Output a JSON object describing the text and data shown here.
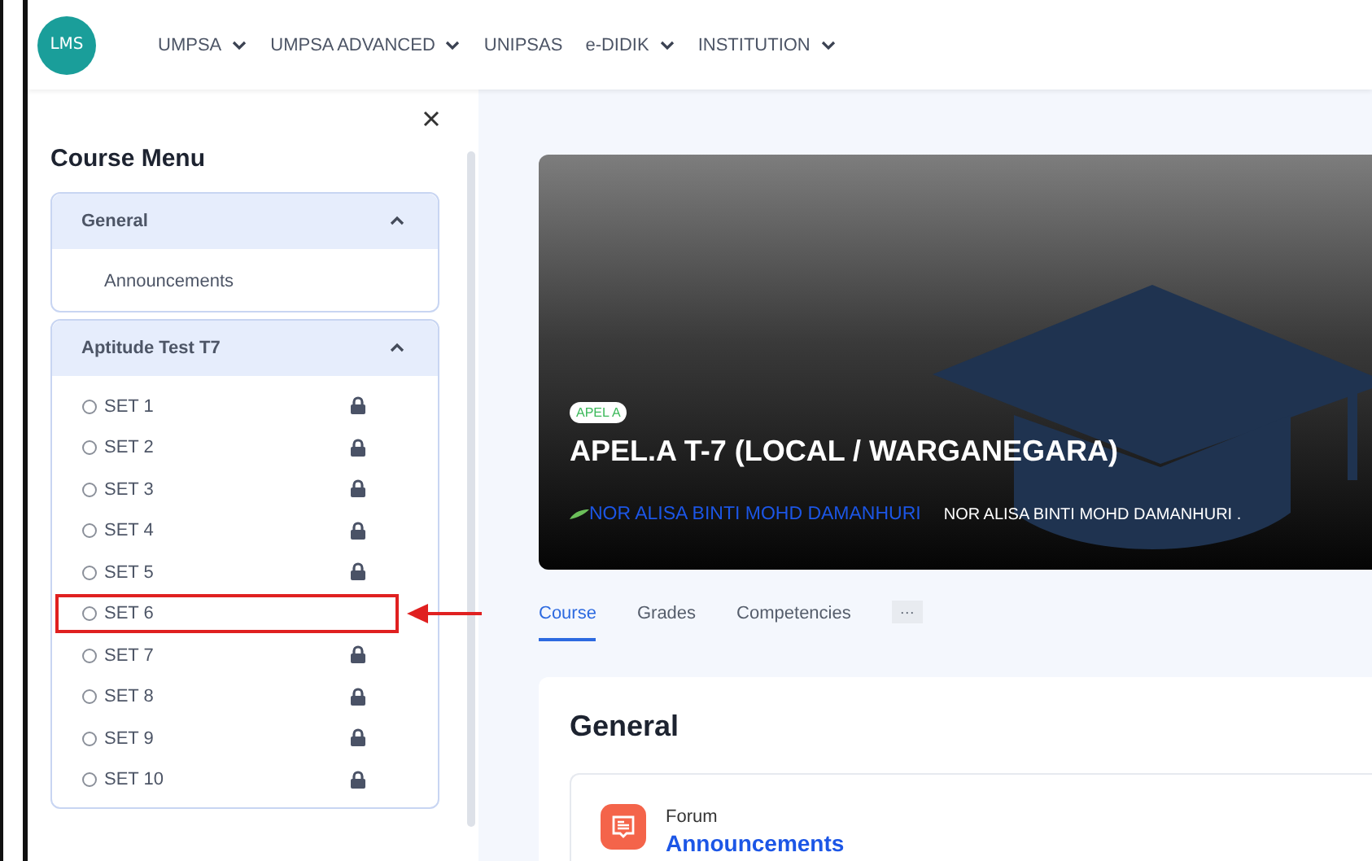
{
  "logo": {
    "text": "LMS"
  },
  "nav": [
    {
      "label": "UMPSA",
      "dropdown": true
    },
    {
      "label": "UMPSA ADVANCED",
      "dropdown": true
    },
    {
      "label": "UNIPSAS",
      "dropdown": false
    },
    {
      "label": "e-DIDIK",
      "dropdown": true
    },
    {
      "label": "INSTITUTION",
      "dropdown": true
    }
  ],
  "drawer": {
    "title": "Course Menu",
    "sections": [
      {
        "title": "General",
        "expanded": true,
        "items": [
          {
            "kind": "link",
            "label": "Announcements",
            "locked": false,
            "annotated": false
          }
        ]
      },
      {
        "title": "Aptitude Test T7",
        "expanded": true,
        "items": [
          {
            "kind": "activity",
            "label": "SET 1",
            "locked": true,
            "annotated": false
          },
          {
            "kind": "activity",
            "label": "SET 2",
            "locked": true,
            "annotated": false
          },
          {
            "kind": "activity",
            "label": "SET 3",
            "locked": true,
            "annotated": false
          },
          {
            "kind": "activity",
            "label": "SET 4",
            "locked": true,
            "annotated": false
          },
          {
            "kind": "activity",
            "label": "SET 5",
            "locked": true,
            "annotated": false
          },
          {
            "kind": "activity",
            "label": "SET 6",
            "locked": false,
            "annotated": true
          },
          {
            "kind": "activity",
            "label": "SET 7",
            "locked": true,
            "annotated": false
          },
          {
            "kind": "activity",
            "label": "SET 8",
            "locked": true,
            "annotated": false
          },
          {
            "kind": "activity",
            "label": "SET 9",
            "locked": true,
            "annotated": false
          },
          {
            "kind": "activity",
            "label": "SET 10",
            "locked": true,
            "annotated": false
          }
        ]
      }
    ]
  },
  "hero": {
    "badge": "APEL A",
    "title": "APEL.A T-7 (LOCAL / WARGANEGARA)",
    "teacher_link": "NOR ALISA BINTI MOHD DAMANHURI",
    "teacher_name": "NOR ALISA BINTI MOHD DAMANHURI ."
  },
  "tabs": [
    {
      "label": "Course",
      "selected": true
    },
    {
      "label": "Grades",
      "selected": false
    },
    {
      "label": "Competencies",
      "selected": false
    },
    {
      "label": "···",
      "selected": false
    }
  ],
  "section": {
    "title": "General",
    "activity": {
      "type": "Forum",
      "name": "Announcements"
    }
  }
}
